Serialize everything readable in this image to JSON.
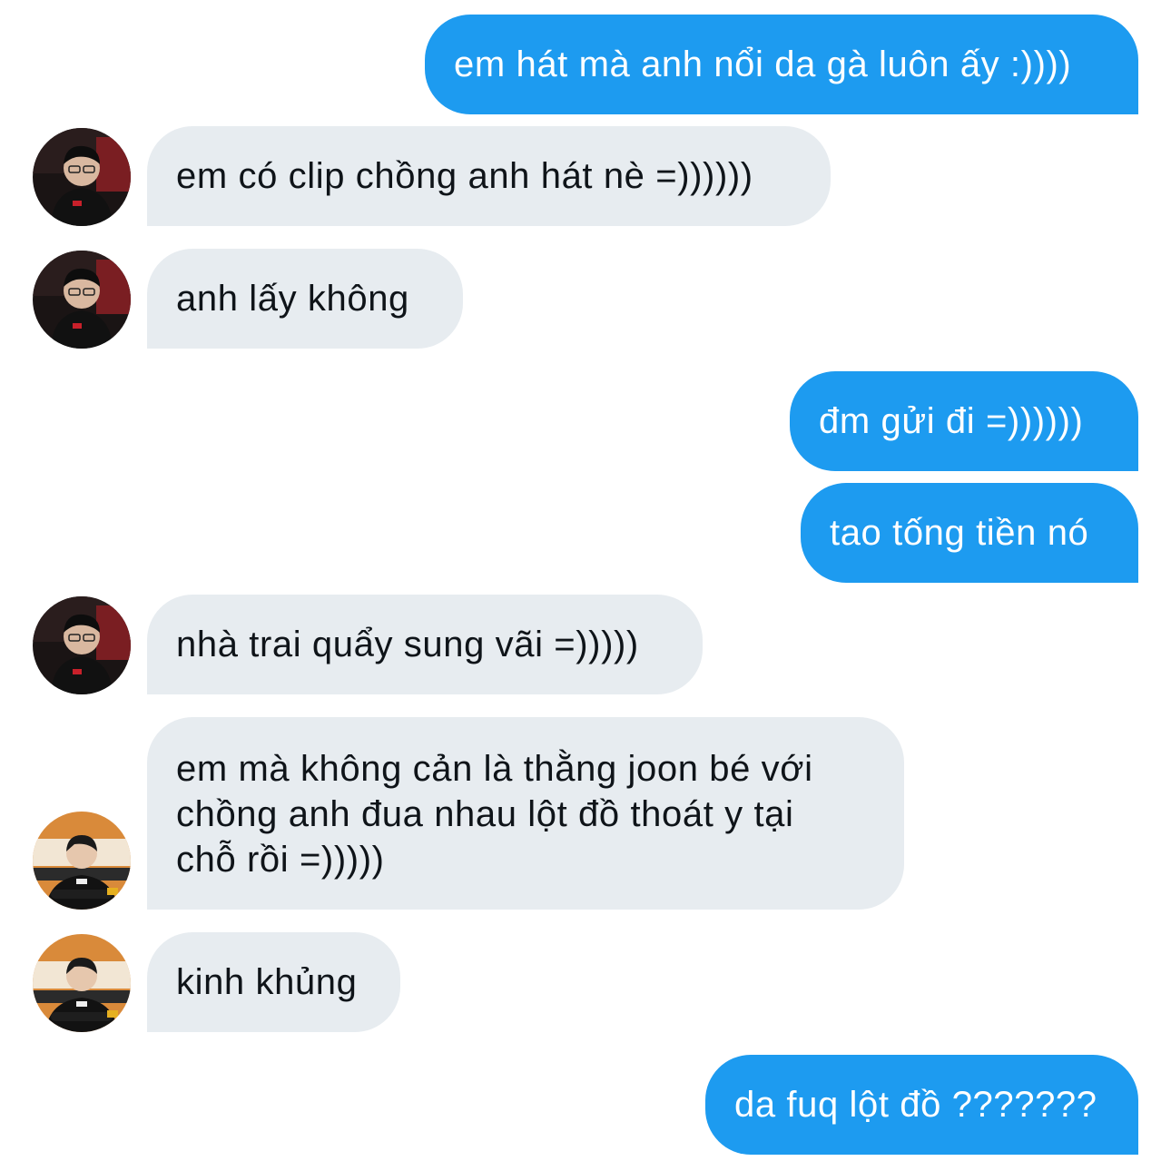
{
  "conversation": {
    "messages": [
      {
        "direction": "outgoing",
        "text": "em hát mà anh nổi da gà luôn ấy :))))"
      },
      {
        "direction": "incoming",
        "sender": "contact-a",
        "text": "em có clip chồng anh hát nè =))))))"
      },
      {
        "direction": "incoming",
        "sender": "contact-a",
        "text": "anh lấy không"
      },
      {
        "direction": "outgoing",
        "text": "đm gửi đi =))))))"
      },
      {
        "direction": "outgoing",
        "text": "tao tống tiền nó"
      },
      {
        "direction": "incoming",
        "sender": "contact-a",
        "text": "nhà trai quẩy sung vãi =)))))"
      },
      {
        "direction": "incoming",
        "sender": "contact-b",
        "lines": [
          "em mà không cản là thằng joon bé với",
          "chồng anh đua nhau lột đồ thoát y tại",
          "chỗ rồi =)))))"
        ]
      },
      {
        "direction": "incoming",
        "sender": "contact-b",
        "text": "kinh khủng"
      },
      {
        "direction": "outgoing",
        "text": "da fuq lột đồ ???????"
      }
    ]
  },
  "colors": {
    "outgoing_bubble": "#1d9bf0",
    "incoming_bubble": "#e7ecf0",
    "incoming_text": "#0f1419",
    "outgoing_text": "#ffffff"
  },
  "avatars": {
    "contact-a": "avatar-dark-gaming-chair",
    "contact-b": "avatar-orange-backdrop"
  }
}
